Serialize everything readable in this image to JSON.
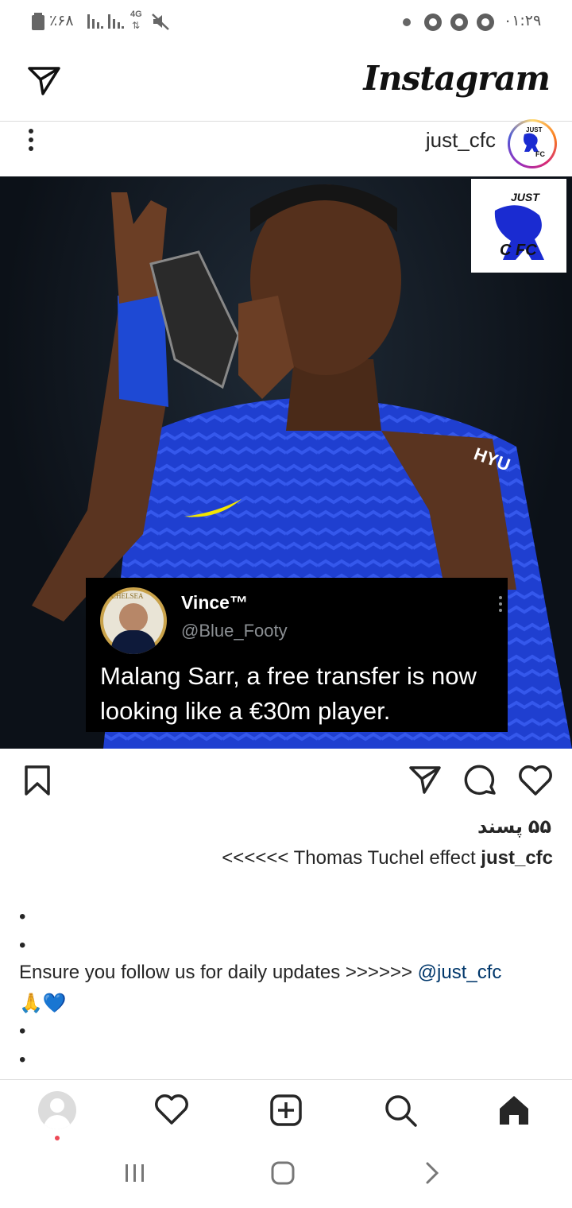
{
  "status_bar": {
    "battery": "٪۶۸",
    "network": "4G",
    "time": "۰۱:۲۹"
  },
  "header": {
    "logo": "Instagram",
    "direct_icon": "paper-plane-icon"
  },
  "post": {
    "username": "just_cfc",
    "avatar_text_top": "JUST",
    "avatar_text_bottom": "FC",
    "image": {
      "corner_logo_top": "JUST",
      "corner_logo_bottom": "C FC",
      "jersey_text": "HYU",
      "tweet": {
        "name": "Vince™",
        "handle": "@Blue_Footy",
        "badge_text": "CHELSEA",
        "text": "Malang Sarr, a free transfer is now looking like a €30m player."
      }
    },
    "likes": "۵۵ پسند",
    "caption_text": "<<<<<< Thomas Tuchel effect",
    "caption_username": "just_cfc",
    "follow_text": "Ensure you follow us for daily updates >>>>>>",
    "follow_mention": "@just_cfc",
    "emojis": "🙏💙",
    "bullet": "•"
  },
  "bottom_nav": {
    "items": [
      "profile",
      "activity",
      "new-post",
      "search",
      "home"
    ]
  },
  "colors": {
    "accent_blue": "#034694",
    "link": "#00376b",
    "notification_dot": "#ed4956"
  }
}
